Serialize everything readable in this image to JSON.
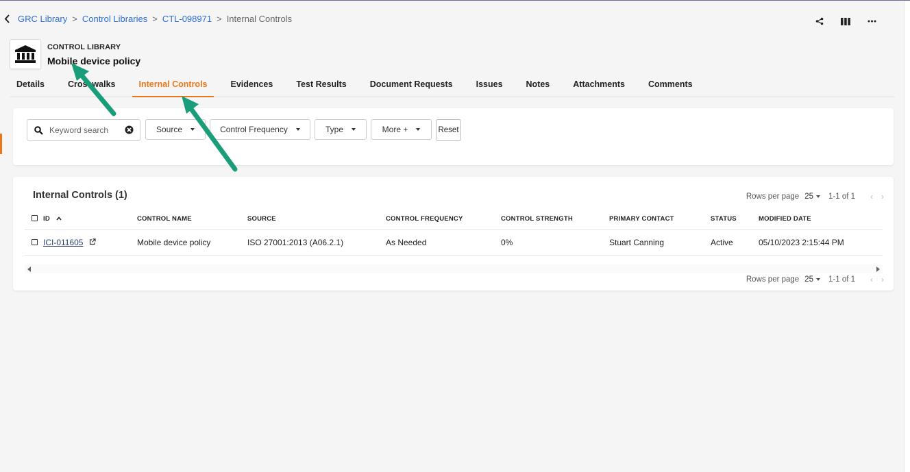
{
  "breadcrumb": {
    "items": [
      "GRC Library",
      "Control Libraries",
      "CTL-098971"
    ],
    "current": "Internal Controls",
    "separator": ">"
  },
  "top_actions": [
    "share-icon",
    "columns-icon",
    "more-icon"
  ],
  "header": {
    "type_label": "CONTROL LIBRARY",
    "title": "Mobile device policy",
    "icon": "bank-icon"
  },
  "tabs": [
    {
      "label": "Details"
    },
    {
      "label": "Crosswalks"
    },
    {
      "label": "Internal Controls",
      "active": true
    },
    {
      "label": "Evidences"
    },
    {
      "label": "Test Results"
    },
    {
      "label": "Document Requests"
    },
    {
      "label": "Issues"
    },
    {
      "label": "Notes"
    },
    {
      "label": "Attachments"
    },
    {
      "label": "Comments"
    }
  ],
  "filters": {
    "search_placeholder": "Keyword search",
    "source": "Source",
    "frequency": "Control Frequency",
    "type": "Type",
    "more": "More +",
    "reset": "Reset"
  },
  "table": {
    "title": "Internal Controls (1)",
    "pager": {
      "rows_label": "Rows per page",
      "rows_value": "25",
      "range": "1-1 of 1"
    },
    "columns": [
      "ID",
      "CONTROL NAME",
      "SOURCE",
      "CONTROL FREQUENCY",
      "CONTROL STRENGTH",
      "PRIMARY CONTACT",
      "STATUS",
      "MODIFIED DATE"
    ],
    "rows": [
      {
        "id": "ICI-011605",
        "name": "Mobile device policy",
        "source": "ISO 27001:2013 (A06.2.1)",
        "frequency": "As Needed",
        "strength": "0%",
        "contact": "Stuart Canning",
        "status": "Active",
        "modified": "05/10/2023 2:15:44 PM"
      }
    ]
  },
  "colors": {
    "accent": "#e8781e",
    "link": "#2c6ed5",
    "annotation_arrow": "#1a9e7a"
  }
}
